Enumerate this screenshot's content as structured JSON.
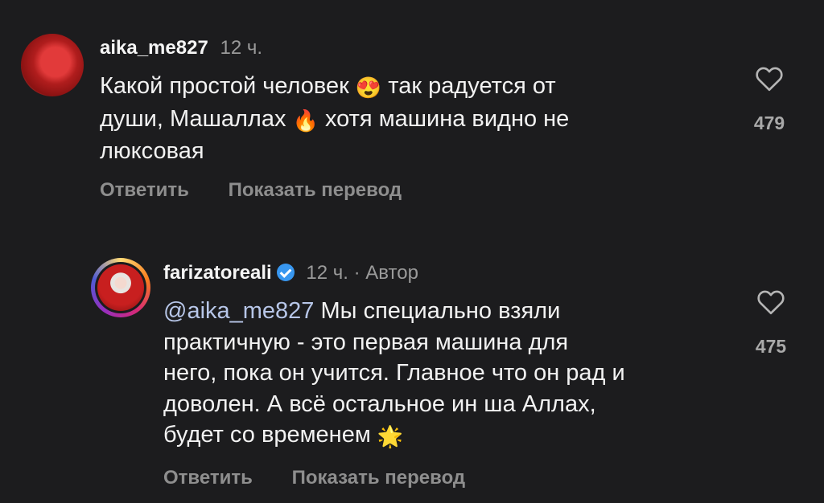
{
  "comments": [
    {
      "username": "aika_me827",
      "time": "12 ч.",
      "text_parts": [
        "Какой простой человек ",
        "😍",
        " так радуется от\nдуши, Машаллах ",
        "🔥",
        " хотя машина видно не\nлюксовая"
      ],
      "reply_label": "Ответить",
      "translate_label": "Показать перевод",
      "likes": "479"
    },
    {
      "username": "farizatoreali",
      "time": "12 ч.",
      "author_label": "· Автор",
      "mention": "@aika_me827",
      "text_parts": [
        " Мы специально взяли\nпрактичную - это первая машина для\nнего, пока он учится. Главное что он рад и\nдоволен. А всё остальное ин ша Аллах,\nбудет со временем ",
        "🌟"
      ],
      "reply_label": "Ответить",
      "translate_label": "Показать перевод",
      "likes": "475"
    }
  ]
}
